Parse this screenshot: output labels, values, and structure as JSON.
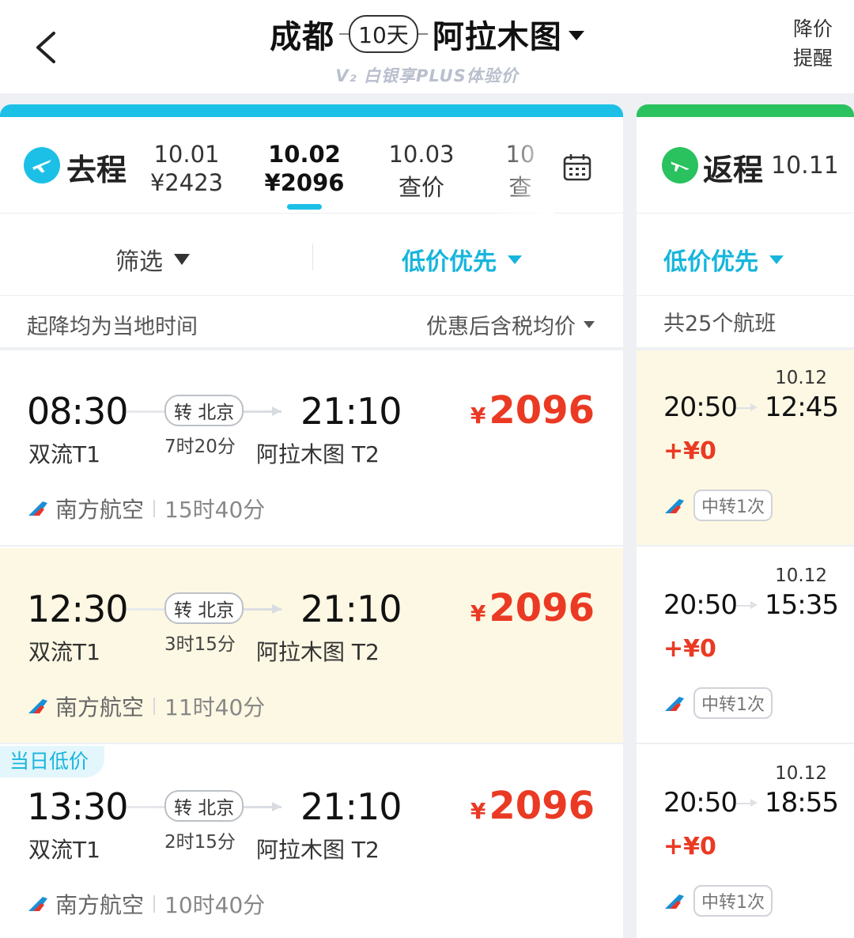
{
  "header": {
    "from_city": "成都",
    "duration": "10天",
    "to_city": "阿拉木图",
    "plus_text": "V₂ 白银享PLUS体验价",
    "alert_line1": "降价",
    "alert_line2": "提醒"
  },
  "outbound": {
    "label": "去程",
    "dates": [
      {
        "date": "10.01",
        "price": "¥2423"
      },
      {
        "date": "10.02",
        "price": "¥2096",
        "active": true
      },
      {
        "date": "10.03",
        "price": "查价"
      },
      {
        "date": "10",
        "price": "查"
      }
    ],
    "filter_label": "筛选",
    "sort_label": "低价优先",
    "info_left": "起降均为当地时间",
    "info_right": "优惠后含税均价",
    "flights": [
      {
        "dep_time": "08:30",
        "dep_airport": "双流T1",
        "transfer": "转 北京",
        "leg_duration": "7时20分",
        "arr_time": "21:10",
        "arr_airport": "阿拉木图 T2",
        "price_symbol": "¥",
        "price": "2096",
        "airline": "南方航空",
        "total_duration": "15时40分"
      },
      {
        "dep_time": "12:30",
        "dep_airport": "双流T1",
        "transfer": "转 北京",
        "leg_duration": "3时15分",
        "arr_time": "21:10",
        "arr_airport": "阿拉木图 T2",
        "price_symbol": "¥",
        "price": "2096",
        "airline": "南方航空",
        "total_duration": "11时40分"
      },
      {
        "badge": "当日低价",
        "dep_time": "13:30",
        "dep_airport": "双流T1",
        "transfer": "转 北京",
        "leg_duration": "2时15分",
        "arr_time": "21:10",
        "arr_airport": "阿拉木图 T2",
        "price_symbol": "¥",
        "price": "2096",
        "airline": "南方航空",
        "total_duration": "10时40分"
      }
    ]
  },
  "return": {
    "label": "返程",
    "date": "10.11",
    "sort_label": "低价优先",
    "count_text": "共25个航班",
    "flights": [
      {
        "arr_date": "10.12",
        "dep_time": "20:50",
        "arr_time": "12:45",
        "extra": "+¥0",
        "transfer": "中转1次"
      },
      {
        "arr_date": "10.12",
        "dep_time": "20:50",
        "arr_time": "15:35",
        "extra": "+¥0",
        "transfer": "中转1次"
      },
      {
        "arr_date": "10.12",
        "dep_time": "20:50",
        "arr_time": "18:55",
        "extra": "+¥0",
        "transfer": "中转1次"
      }
    ]
  },
  "colors": {
    "accent": "#1cc0e6",
    "return_accent": "#2ac25e",
    "price": "#ea3a24",
    "highlight": "#fdf8e3"
  }
}
